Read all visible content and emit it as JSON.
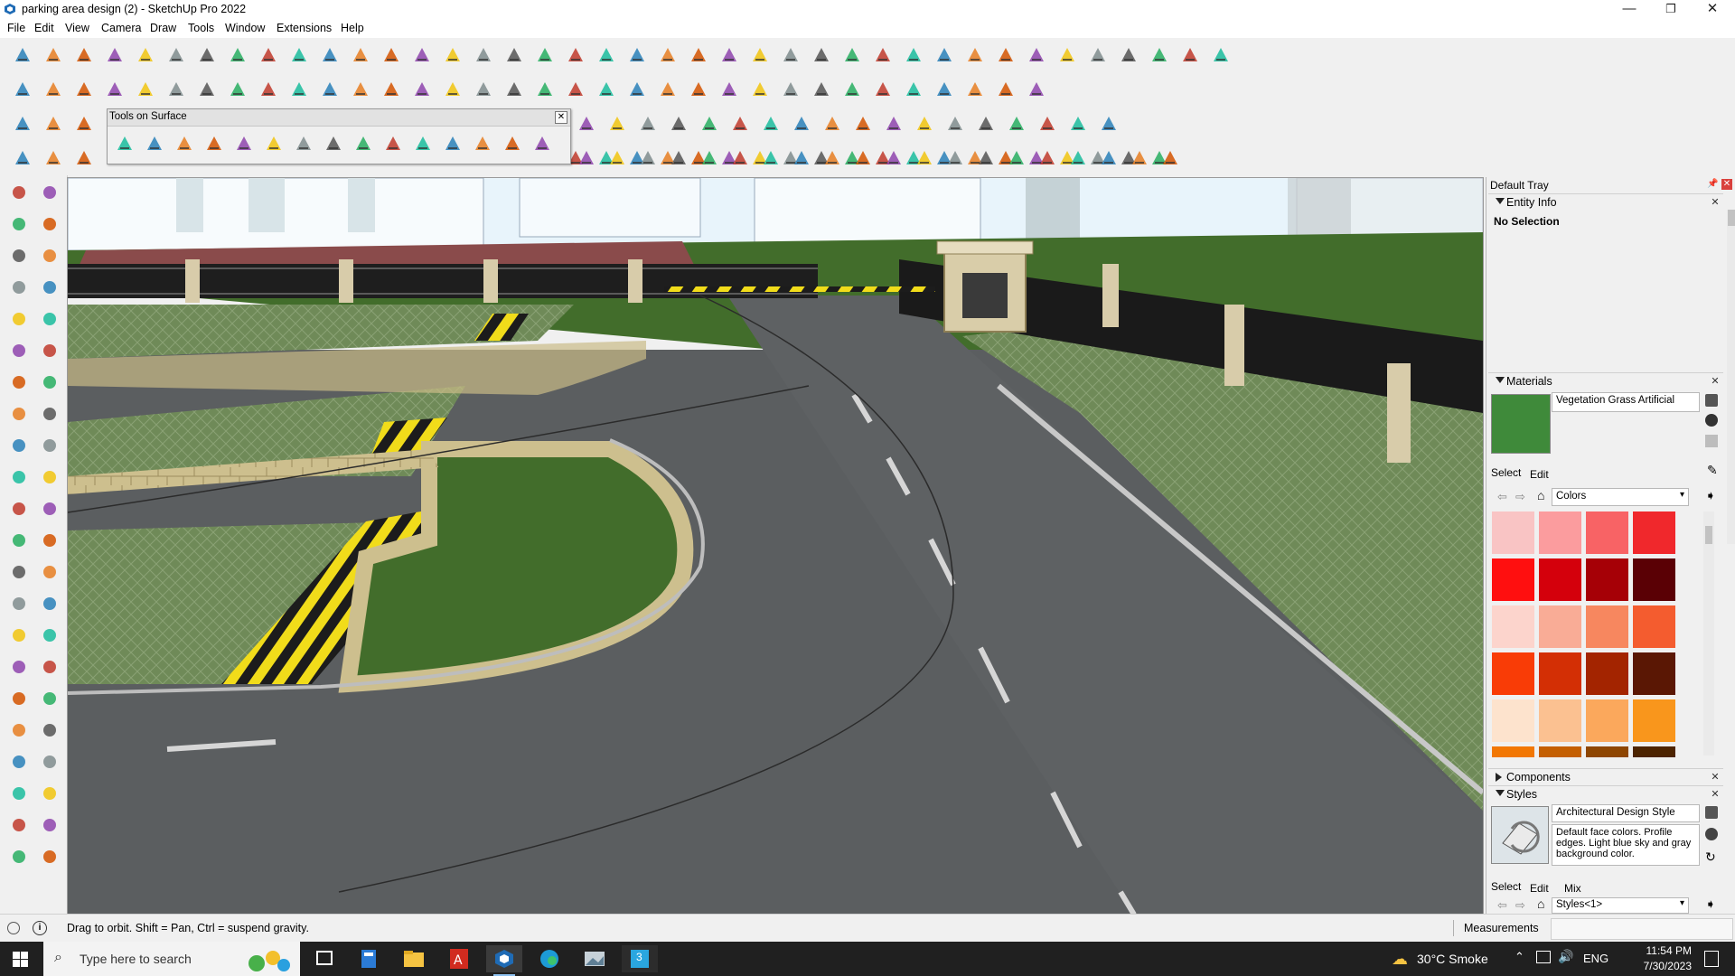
{
  "window": {
    "title": "parking area design (2) - SketchUp Pro 2022",
    "minimize": "—",
    "maximize": "❐",
    "close": "✕"
  },
  "menu": {
    "items": [
      "File",
      "Edit",
      "View",
      "Camera",
      "Draw",
      "Tools",
      "Window",
      "Extensions",
      "Help"
    ]
  },
  "tools_on_surface": {
    "title": "Tools on Surface",
    "close": "✕"
  },
  "tray": {
    "title": "Default Tray",
    "entity_info": {
      "label": "Entity Info",
      "value": "No Selection"
    },
    "materials": {
      "label": "Materials",
      "name": "Vegetation Grass Artificial",
      "tab_select": "Select",
      "tab_edit": "Edit",
      "library": "Colors",
      "colors": [
        "#f9c4c4",
        "#fb9c9e",
        "#f86365",
        "#f0282c",
        "#ff0f0f",
        "#d4000c",
        "#a60006",
        "#5a0005",
        "#fcd4cc",
        "#f9ac96",
        "#f7875f",
        "#f45c2f",
        "#f93c06",
        "#d32f05",
        "#a32400",
        "#5a1704",
        "#fde3cd",
        "#fbc191",
        "#fba85c",
        "#f9961c",
        "#f27703",
        "#c45f02",
        "#8e4602",
        "#4d2401"
      ]
    },
    "components": {
      "label": "Components"
    },
    "styles": {
      "label": "Styles",
      "name": "Architectural Design Style",
      "description": "Default face colors. Profile edges. Light blue sky and gray background color.",
      "tab_select": "Select",
      "tab_edit": "Edit",
      "tab_mix": "Mix",
      "library": "Styles<1>"
    }
  },
  "status": {
    "hint": "Drag to orbit. Shift = Pan, Ctrl = suspend gravity.",
    "measurements_label": "Measurements",
    "measurements_value": ""
  },
  "taskbar": {
    "search_placeholder": "Type here to search",
    "weather": "30°C  Smoke",
    "language": "ENG",
    "time": "11:54 PM",
    "date": "7/30/2023",
    "sketchup_badge": "3"
  },
  "colors": {
    "sky": "#e8f4fb",
    "road": "#5b5e60",
    "grass": "#426d2b",
    "paving": "#6f8a58",
    "stone": "#cdbf8e",
    "hazard_yellow": "#f1dc1a",
    "accent_blue": "#0a64c8"
  }
}
